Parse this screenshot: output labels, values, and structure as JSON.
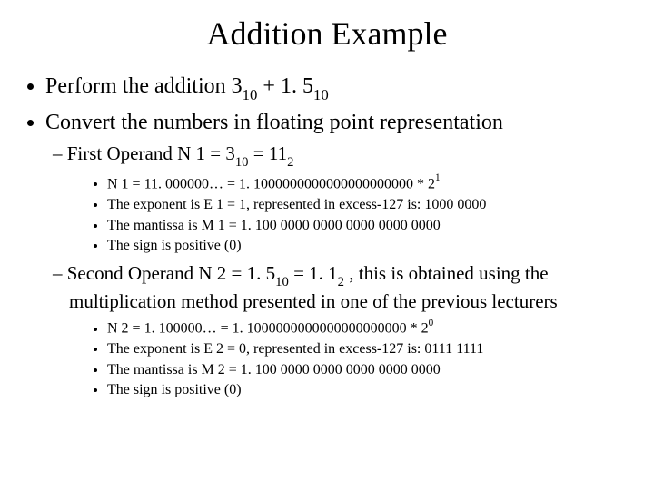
{
  "title": "Addition Example",
  "bullets": {
    "b1": {
      "pre": "Perform the addition 3",
      "s1": "10",
      "mid": " + 1. 5",
      "s2": "10"
    },
    "b2": "Convert the numbers in floating point representation",
    "op1": {
      "line": {
        "pre": "First Operand N 1 = 3",
        "s1": "10",
        "mid": " = 11",
        "s2": "2"
      },
      "d1": {
        "pre": "N 1 = 11. 000000… = 1. 1000000000000000000000 * 2",
        "sup": "1"
      },
      "d2": "The exponent is E 1 = 1, represented in excess-127 is: 1000 0000",
      "d3": "The mantissa is M 1 = 1. 100 0000 0000 0000 0000 0000",
      "d4": "The sign is positive (0)"
    },
    "op2": {
      "line": {
        "pre": "Second Operand N 2 = 1. 5",
        "s1": "10",
        "mid": " = 1. 1",
        "s2": "2",
        "tail": " , this is obtained using the multiplication method presented in one of the previous lecturers"
      },
      "d1": {
        "pre": "N 2 = 1. 100000… = 1. 1000000000000000000000 * 2",
        "sup": "0"
      },
      "d2": "The exponent is E 2 = 0, represented in excess-127 is: 0111 1111",
      "d3": "The mantissa is M 2 = 1. 100 0000 0000 0000 0000 0000",
      "d4": "The sign is positive (0)"
    }
  }
}
